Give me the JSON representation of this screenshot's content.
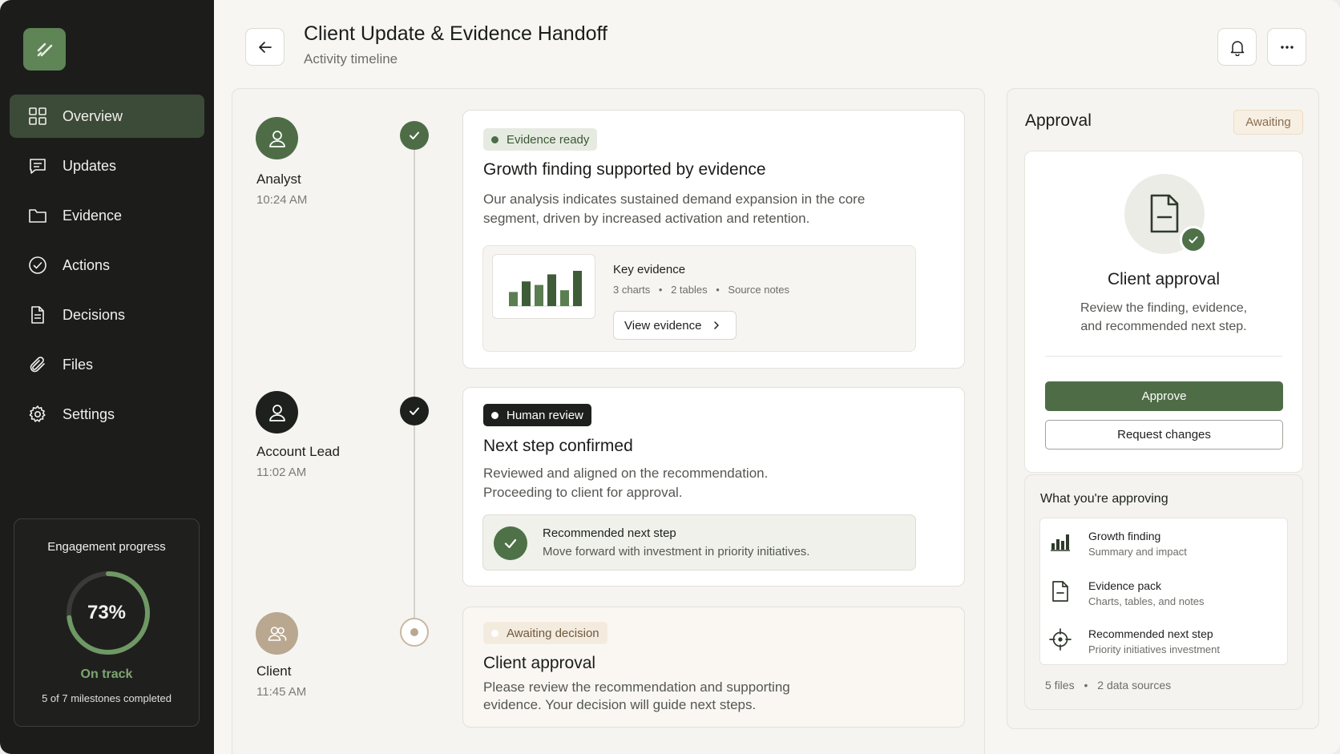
{
  "header": {
    "title": "Client Update & Evidence Handoff",
    "subtitle": "Activity timeline"
  },
  "sidebar": {
    "items": [
      {
        "label": "Overview",
        "icon": "grid-icon",
        "active": true
      },
      {
        "label": "Updates",
        "icon": "message-icon"
      },
      {
        "label": "Evidence",
        "icon": "folder-icon"
      },
      {
        "label": "Actions",
        "icon": "check-circle-icon"
      },
      {
        "label": "Decisions",
        "icon": "document-icon"
      },
      {
        "label": "Files",
        "icon": "paperclip-icon"
      },
      {
        "label": "Settings",
        "icon": "gear-icon"
      }
    ],
    "progress": {
      "title": "Engagement progress",
      "percent_label": "73%",
      "percent": 73,
      "status": "On track",
      "milestones": "5 of 7 milestones completed"
    }
  },
  "timeline": [
    {
      "who": "Analyst",
      "time": "10:24 AM",
      "chip": "Evidence ready",
      "title": "Growth finding supported by evidence",
      "body": "Our analysis indicates sustained demand expansion in the core segment, driven by increased activation and retention.",
      "evidence": {
        "title": "Key evidence",
        "meta": [
          "3 charts",
          "2 tables",
          "Source notes"
        ],
        "button": "View evidence",
        "thumb_values": [
          0.4,
          0.7,
          0.6,
          0.9,
          0.45,
          1.0
        ]
      }
    },
    {
      "who": "Account Lead",
      "time": "11:02 AM",
      "chip": "Human review",
      "title": "Next step confirmed",
      "body_lines": [
        "Reviewed and aligned on the recommendation.",
        "Proceeding to client for approval."
      ],
      "recommendation": {
        "title": "Recommended next step",
        "subtitle": "Move forward with investment in priority initiatives."
      }
    },
    {
      "who": "Client",
      "time": "11:45 AM",
      "chip": "Awaiting decision",
      "title": "Client approval",
      "body_lines": [
        "Please review the recommendation and supporting",
        "evidence. Your decision will guide next steps."
      ]
    }
  ],
  "approval": {
    "title": "Approval",
    "badge": "Awaiting",
    "card_title": "Client approval",
    "desc_lines": [
      "Review the finding, evidence,",
      "and recommended next step."
    ],
    "approve": "Approve",
    "request_changes": "Request changes",
    "list_title": "What you're approving",
    "items": [
      {
        "title": "Growth finding",
        "subtitle": "Summary and impact",
        "icon": "bar-chart-icon"
      },
      {
        "title": "Evidence pack",
        "subtitle": "Charts, tables, and notes",
        "icon": "document-icon"
      },
      {
        "title": "Recommended next step",
        "subtitle": "Priority initiatives investment",
        "icon": "target-icon"
      }
    ],
    "footer": [
      "5 files",
      "2 data sources"
    ]
  },
  "colors": {
    "sidebar_bg": "#1c1d1b",
    "accent_green": "#4e6d47",
    "active_nav": "#3c4a38",
    "awaiting": "#f8efe3"
  }
}
